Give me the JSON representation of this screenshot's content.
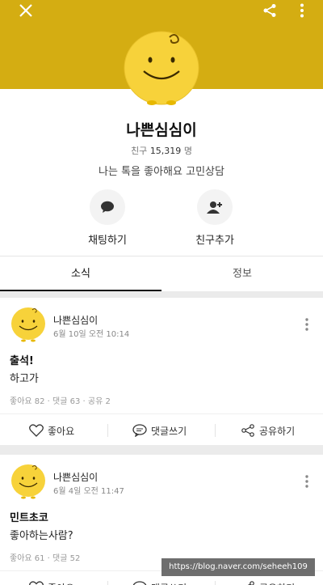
{
  "profile": {
    "name": "나쁜심심이",
    "friends_label": "친구",
    "friends_count": "15,319",
    "friends_unit": "명",
    "status": "나는 톡을 좋아해요 고민상담"
  },
  "actions": {
    "chat_label": "채팅하기",
    "add_friend_label": "친구추가"
  },
  "tabs": [
    {
      "label": "소식"
    },
    {
      "label": "정보"
    }
  ],
  "posts": [
    {
      "author": "나쁜심심이",
      "date": "6월 10일 오전 10:14",
      "title": "출석!",
      "body": "하고가",
      "stats": "좋아요 82 · 댓글 63 · 공유 2"
    },
    {
      "author": "나쁜심심이",
      "date": "6월 4일 오전 11:47",
      "title": "민트초코",
      "body": "좋아하는사람?",
      "stats": "좋아요 61 · 댓글 52"
    }
  ],
  "post_actions": {
    "like": "좋아요",
    "comment": "댓글쓰기",
    "share": "공유하기"
  },
  "watermark": "https://blog.naver.com/seheeh109",
  "colors": {
    "banner": "#d4ad12",
    "character": "#f7d23a"
  }
}
